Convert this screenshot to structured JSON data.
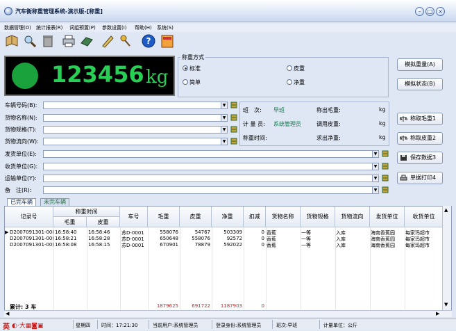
{
  "window": {
    "title": "汽车衡称重管理系统-演示版-[称重]",
    "controls": [
      "minimize",
      "maximize",
      "close"
    ]
  },
  "menu": [
    "数据管理(D)",
    "统计报表(R)",
    "词组预置(P)",
    "参数设置(I)",
    "帮助(H)",
    "系统(S)"
  ],
  "toolbar": [
    "book-icon",
    "find-icon",
    "trash-icon",
    "printer-icon",
    "export-icon",
    "pen-icon",
    "keys-icon",
    "help-icon",
    "exit-icon"
  ],
  "display": {
    "weight": "123456",
    "unit": "kg"
  },
  "mode": {
    "legend": "称重方式",
    "options": [
      "标准",
      "皮重",
      "简单",
      "净重"
    ],
    "selected": "标准"
  },
  "side_buttons": {
    "simulate_weight": "模拟重量(A)",
    "simulate_status": "模拟状态(B)"
  },
  "fields": [
    {
      "label": "车辆号码(B):",
      "value": ""
    },
    {
      "label": "货物名称(N):",
      "value": ""
    },
    {
      "label": "货物规格(T):",
      "value": ""
    },
    {
      "label": "货物流向(W):",
      "value": ""
    },
    {
      "label": "发货单位(E):",
      "value": ""
    },
    {
      "label": "收货单位(G):",
      "value": ""
    },
    {
      "label": "运输单位(Y):",
      "value": ""
    },
    {
      "label": "备　注(R):",
      "value": ""
    }
  ],
  "info": {
    "shift_label": "班　次:",
    "shift_value": "早班",
    "gross_label": "称出毛重:",
    "gross_unit": "kg",
    "operator_label": "计 量 员:",
    "operator_value": "系统管理员",
    "tare_label": "调用皮重:",
    "tare_unit": "kg",
    "time_label": "称重时间:",
    "net_label": "求出净重:",
    "net_unit": "kg"
  },
  "action_buttons": [
    "称取毛重1",
    "称取皮重2",
    "保存数据3",
    "单据打印4"
  ],
  "tabs": [
    "已完车辆",
    "未完车辆"
  ],
  "table": {
    "headers": [
      "记录号",
      "称重时间",
      "毛重",
      "皮重",
      "车号",
      "毛重",
      "皮重",
      "净重",
      "扣减",
      "货物名称",
      "货物规格",
      "货物流向",
      "发货单位",
      "收货单位"
    ],
    "rows": [
      [
        "D2007091301-00(",
        "16:58:40",
        "16:58:46",
        "苏D-0001",
        "558076",
        "54767",
        "503309",
        "0",
        "香蕉",
        "一等",
        "入库",
        "海南香蕉园",
        "每家玛超市"
      ],
      [
        "D2007091301-00(",
        "16:58:21",
        "16:58:28",
        "苏D-0001",
        "650648",
        "558076",
        "92572",
        "0",
        "香蕉",
        "一等",
        "入库",
        "海南香蕉园",
        "每家玛超市"
      ],
      [
        "D2007091301-00(",
        "16:58:08",
        "16:58:15",
        "苏D-0001",
        "670901",
        "78879",
        "592022",
        "0",
        "香蕉",
        "一等",
        "入库",
        "海南香蕉园",
        "每家玛超市"
      ]
    ],
    "total_label": "累计: 3 车",
    "totals": {
      "gross": "1879625",
      "tare": "691722",
      "net": "1187903",
      "deduct": "0"
    }
  },
  "status": {
    "weekday": "星期四",
    "time": "时间：17:21:30",
    "user": "当前用户:系统管理员",
    "role": "登录身份:系统管理员",
    "shift": "班次:早班",
    "unit": "计量单位：公斤",
    "ime": "英"
  }
}
